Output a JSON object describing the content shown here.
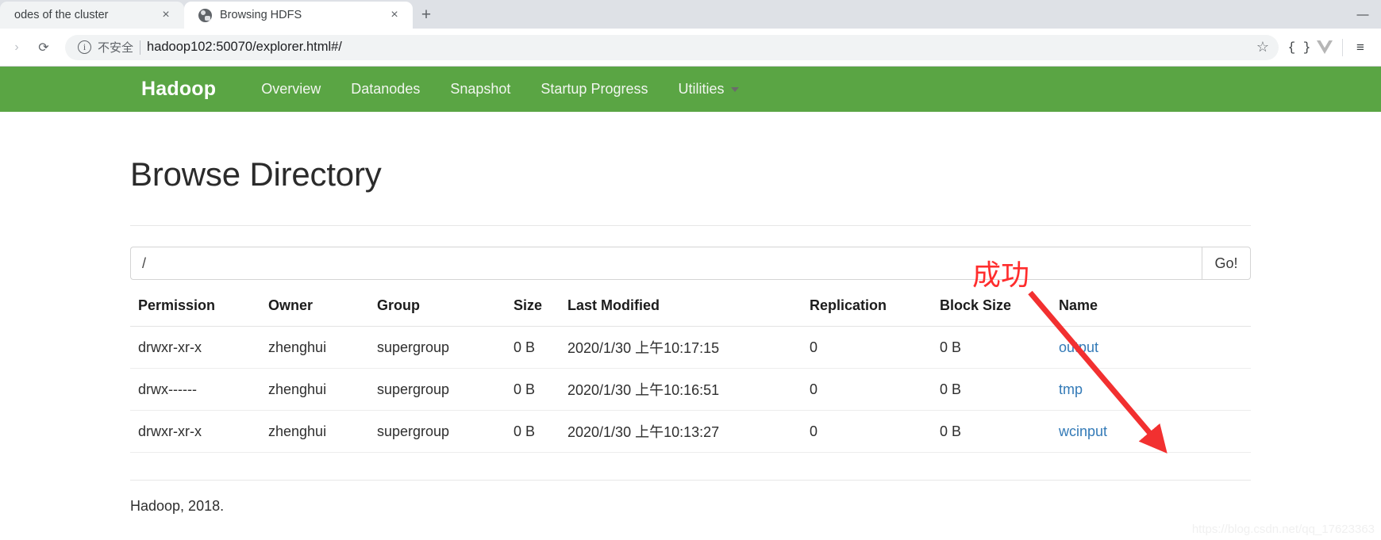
{
  "browser": {
    "tabs": [
      {
        "title": "odes of the cluster",
        "active": false,
        "close_label": "×",
        "favicon": "globe-icon"
      },
      {
        "title": "Browsing HDFS",
        "active": true,
        "close_label": "×",
        "favicon": "globe-icon"
      }
    ],
    "new_tab_label": "+",
    "minimize_label": "—",
    "reload_label": "⟳",
    "forward_label": "›",
    "omnibox": {
      "info_glyph": "i",
      "security_label": "不安全",
      "url": "hadoop102:50070/explorer.html#/",
      "star_label": "☆"
    },
    "extensions": [
      {
        "name": "json-formatter-icon",
        "label": "{ }"
      },
      {
        "name": "vue-devtools-icon",
        "label": "▼"
      }
    ],
    "menu_label": "≡"
  },
  "navbar": {
    "brand": "Hadoop",
    "links": [
      {
        "label": "Overview",
        "caret": false
      },
      {
        "label": "Datanodes",
        "caret": false
      },
      {
        "label": "Snapshot",
        "caret": false
      },
      {
        "label": "Startup Progress",
        "caret": false
      },
      {
        "label": "Utilities",
        "caret": true
      }
    ],
    "background": "#5aa544"
  },
  "main": {
    "title": "Browse Directory",
    "path_value": "/",
    "path_placeholder": "",
    "go_label": "Go!",
    "table": {
      "headers": [
        "Permission",
        "Owner",
        "Group",
        "Size",
        "Last Modified",
        "Replication",
        "Block Size",
        "Name"
      ],
      "rows": [
        {
          "permission": "drwxr-xr-x",
          "owner": "zhenghui",
          "group": "supergroup",
          "size": "0 B",
          "modified": "2020/1/30 上午10:17:15",
          "replication": "0",
          "block_size": "0 B",
          "name": "output"
        },
        {
          "permission": "drwx------",
          "owner": "zhenghui",
          "group": "supergroup",
          "size": "0 B",
          "modified": "2020/1/30 上午10:16:51",
          "replication": "0",
          "block_size": "0 B",
          "name": "tmp"
        },
        {
          "permission": "drwxr-xr-x",
          "owner": "zhenghui",
          "group": "supergroup",
          "size": "0 B",
          "modified": "2020/1/30 上午10:13:27",
          "replication": "0",
          "block_size": "0 B",
          "name": "wcinput"
        }
      ]
    },
    "footer": "Hadoop, 2018."
  },
  "annotations": {
    "success_text": "成功",
    "success_color": "#ff2d2d",
    "arrow_color": "#f23030",
    "watermark": "https://blog.csdn.net/qq_17623363"
  }
}
